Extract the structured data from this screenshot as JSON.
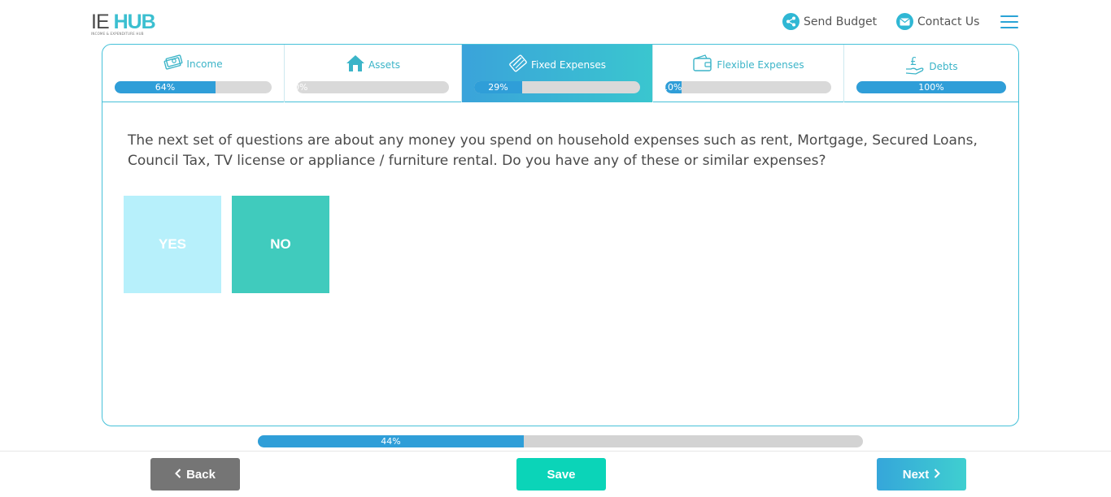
{
  "header": {
    "logo_main_ie": "IE",
    "logo_main_hub": "HUB",
    "logo_sub": "INCOME & EXPENDITURE HUB",
    "send_budget": "Send Budget",
    "contact_us": "Contact Us",
    "icons": [
      "share-icon",
      "mail-icon",
      "menu-icon"
    ]
  },
  "tabs": [
    {
      "label": "Income",
      "percent_label": "64%",
      "progress": 0.64,
      "icon": "money-icon",
      "active": false
    },
    {
      "label": "Assets",
      "percent_label": "0%",
      "progress": 0.0,
      "icon": "house-icon",
      "active": false
    },
    {
      "label": "Fixed Expenses",
      "percent_label": "29%",
      "progress": 0.29,
      "icon": "card-icon",
      "active": true
    },
    {
      "label": "Flexible Expenses",
      "percent_label": "10%",
      "progress": 0.1,
      "icon": "wallet-icon",
      "active": false
    },
    {
      "label": "Debts",
      "percent_label": "100%",
      "progress": 1.0,
      "icon": "pound-hand-icon",
      "active": false
    }
  ],
  "question": "The next set of questions are about any money you spend on household expenses such as rent, Mortgage, Secured Loans, Council Tax, TV license or appliance / furniture rental. Do you have any of these or similar expenses?",
  "choices": {
    "yes": "YES",
    "no": "NO"
  },
  "overall_progress": {
    "percent_label": "44%",
    "progress": 0.44
  },
  "buttons": {
    "back": "Back",
    "save": "Save",
    "next": "Next"
  },
  "colors": {
    "accent": "#2f9ed8",
    "teal": "#40cbbd",
    "light_cyan": "#b7f0fb",
    "save": "#0bd4b8",
    "back": "#757575"
  }
}
